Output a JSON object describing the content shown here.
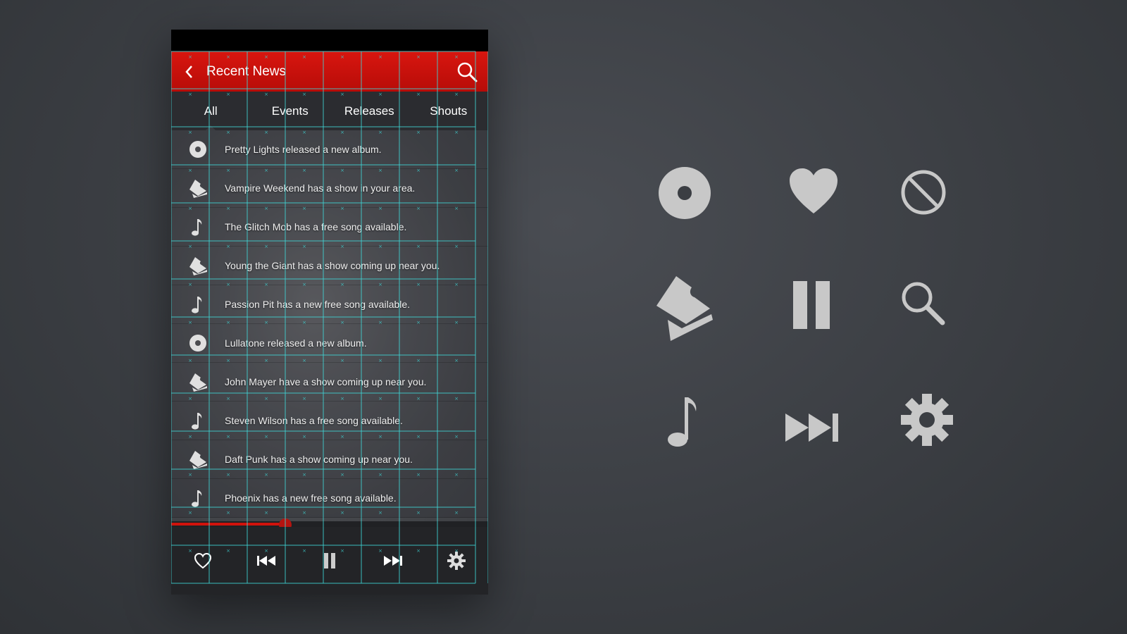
{
  "header": {
    "title": "Recent News",
    "back_icon": "chevron-left-icon",
    "search_icon": "search-icon"
  },
  "tabs": [
    {
      "label": "All",
      "active": true
    },
    {
      "label": "Events",
      "active": false
    },
    {
      "label": "Releases",
      "active": false
    },
    {
      "label": "Shouts",
      "active": false
    }
  ],
  "feed": [
    {
      "icon": "album-icon",
      "text": "Pretty Lights released a new album."
    },
    {
      "icon": "ticket-icon",
      "text": "Vampire Weekend has a show in your area."
    },
    {
      "icon": "music-note-icon",
      "text": "The Glitch Mob has a free song available."
    },
    {
      "icon": "ticket-icon",
      "text": "Young the Giant has a show coming up near you."
    },
    {
      "icon": "music-note-icon",
      "text": "Passion Pit has a new free song available."
    },
    {
      "icon": "album-icon",
      "text": "Lullatone released a new album."
    },
    {
      "icon": "ticket-icon",
      "text": "John Mayer have a show coming up near you."
    },
    {
      "icon": "music-note-icon",
      "text": "Steven Wilson has a free song available."
    },
    {
      "icon": "ticket-icon",
      "text": "Daft Punk has a show coming up near you."
    },
    {
      "icon": "music-note-icon",
      "text": "Phoenix has a new free song available."
    }
  ],
  "player": {
    "progress": 0.36,
    "buttons": [
      "heart-icon",
      "previous-icon",
      "pause-icon",
      "next-icon",
      "gear-icon"
    ]
  },
  "showcase_icons": [
    "album-icon",
    "heart-icon",
    "block-icon",
    "ticket-icon",
    "pause-icon",
    "search-icon",
    "music-note-icon",
    "fast-forward-icon",
    "gear-icon"
  ],
  "colors": {
    "accent": "#d1130c",
    "grid_overlay": "#3fd6d6",
    "icon": "#c8c8c8",
    "background": "#3b3e43"
  }
}
